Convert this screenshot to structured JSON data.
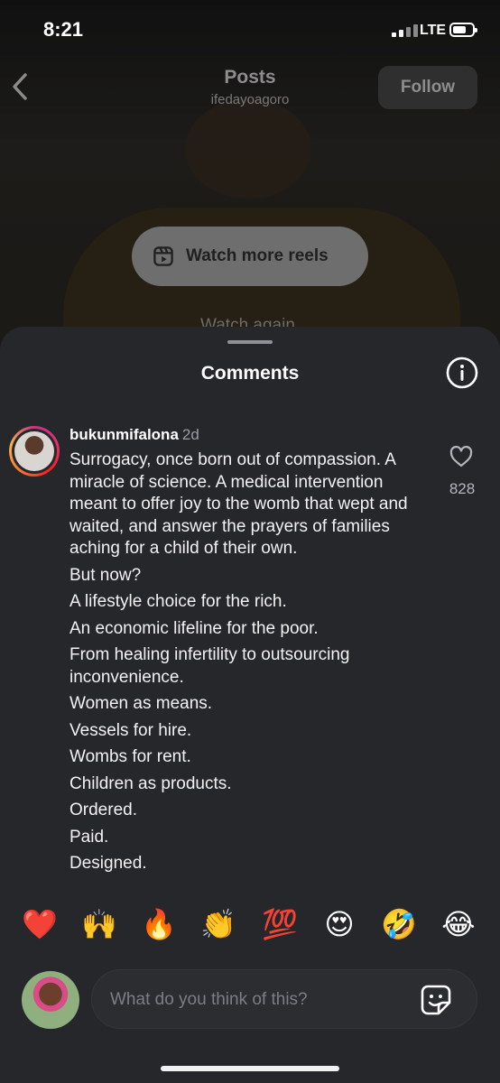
{
  "status_bar": {
    "time": "8:21",
    "network": "LTE"
  },
  "nav": {
    "title": "Posts",
    "username": "ifedayoagoro",
    "follow_label": "Follow"
  },
  "reels": {
    "label": "Watch more reels",
    "faint_text": "Watch again"
  },
  "sheet": {
    "title": "Comments"
  },
  "comment": {
    "username": "bukunmifalona",
    "time_ago": "2d",
    "like_count": "828",
    "paragraphs": [
      "Surrogacy, once born out of compassion. A miracle of science. A medical intervention meant to offer joy to the womb that wept and waited, and answer the prayers of families aching for a child of their own.",
      "But now?",
      "A lifestyle choice for the rich.",
      "An economic lifeline for the poor.",
      "From healing infertility to outsourcing inconvenience.",
      "Women as means.",
      "Vessels for hire.",
      "Wombs for rent.",
      "Children as products.",
      "Ordered.",
      "Paid.",
      "Designed."
    ]
  },
  "emojis": [
    "❤️",
    "🙌",
    "🔥",
    "👏",
    "💯",
    "😍",
    "🤣",
    "😂"
  ],
  "compose": {
    "placeholder": "What do you think of this?"
  },
  "icons": {
    "back": "chevron-left-icon",
    "reels": "reels-icon",
    "info": "info-icon",
    "like": "heart-outline-icon",
    "sticker": "sticker-icon"
  }
}
